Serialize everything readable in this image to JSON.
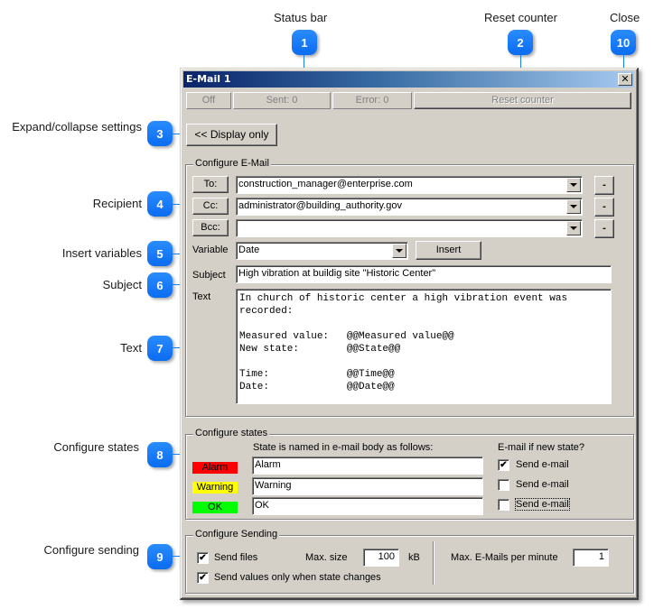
{
  "callouts": [
    {
      "number": "1",
      "label": "Status bar"
    },
    {
      "number": "2",
      "label": "Reset counter"
    },
    {
      "number": "3",
      "label": "Expand/collapse settings"
    },
    {
      "number": "4",
      "label": "Recipient"
    },
    {
      "number": "5",
      "label": "Insert variables"
    },
    {
      "number": "6",
      "label": "Subject"
    },
    {
      "number": "7",
      "label": "Text"
    },
    {
      "number": "8",
      "label": "Configure states"
    },
    {
      "number": "9",
      "label": "Configure sending"
    },
    {
      "number": "10",
      "label": "Close"
    }
  ],
  "window": {
    "title": "E-Mail 1",
    "close_glyph": "✕",
    "accent_title_start": "#0a246a",
    "accent_title_end": "#a6caf0"
  },
  "status_bar": {
    "off": "Off",
    "sent": "Sent: 0",
    "error": "Error: 0",
    "reset_counter": "Reset counter"
  },
  "display_only_button": "<< Display only",
  "configure_email": {
    "title": "Configure E-Mail",
    "to_button": "To:",
    "cc_button": "Cc:",
    "bcc_button": "Bcc:",
    "to_value": "construction_manager@enterprise.com",
    "cc_value": "administrator@building_authority.gov",
    "bcc_value": "",
    "remove_button": "-",
    "variable_label": "Variable",
    "variable_value": "Date",
    "insert_button": "Insert",
    "subject_label": "Subject",
    "subject_value": "High vibration at buildig site \"Historic Center\"",
    "text_label": "Text",
    "text_value": "In church of historic center a high vibration event was\nrecorded:\n\nMeasured value:   @@Measured value@@\nNew state:        @@State@@\n\nTime:             @@Time@@\nDate:             @@Date@@"
  },
  "configure_states": {
    "title": "Configure states",
    "naming_header": "State is named in e-mail body as follows:",
    "email_header": "E-mail if new state?",
    "states": [
      {
        "name": "Alarm",
        "color": "#ff0000",
        "body_name": "Alarm",
        "send_label": "Send e-mail",
        "send": true
      },
      {
        "name": "Warning",
        "color": "#ffff00",
        "body_name": "Warning",
        "send_label": "Send e-mail",
        "send": false
      },
      {
        "name": "OK",
        "color": "#00ff00",
        "body_name": "OK",
        "send_label": "Send e-mail",
        "send": false
      }
    ]
  },
  "configure_sending": {
    "title": "Configure Sending",
    "send_files_label": "Send files",
    "send_files": true,
    "max_size_label": "Max. size",
    "max_size_value": "100",
    "max_size_unit": "kB",
    "send_values_label": "Send values only when state changes",
    "send_values": true,
    "max_emails_label": "Max. E-Mails per minute",
    "max_emails_value": "1"
  }
}
